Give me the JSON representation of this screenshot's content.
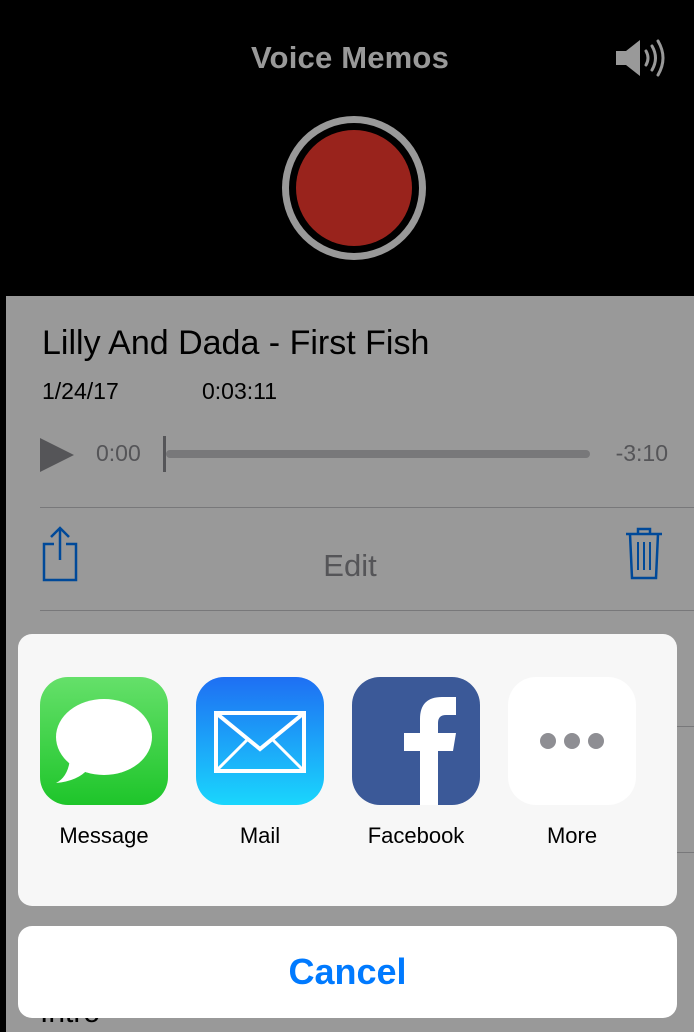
{
  "header": {
    "title": "Voice Memos",
    "speaker_icon": "speaker-volume-icon",
    "record_icon": "record-button"
  },
  "memo": {
    "name": "Lilly And Dada - First Fish",
    "date": "1/24/17",
    "duration": "0:03:11",
    "elapsed": "0:00",
    "remaining": "-3:10",
    "edit_label": "Edit",
    "share_icon": "share-icon",
    "trash_icon": "trash-icon",
    "background_row_label": "Intro"
  },
  "share_sheet": {
    "apps": [
      {
        "label": "Message",
        "icon": "message-icon"
      },
      {
        "label": "Mail",
        "icon": "mail-icon"
      },
      {
        "label": "Facebook",
        "icon": "facebook-icon"
      },
      {
        "label": "More",
        "icon": "more-icon"
      }
    ],
    "cancel_label": "Cancel"
  },
  "colors": {
    "accent": "#007aff",
    "record": "#ff3b30",
    "message": "#1ec52a",
    "mail": "#1e6ff3",
    "facebook": "#3b5998"
  }
}
